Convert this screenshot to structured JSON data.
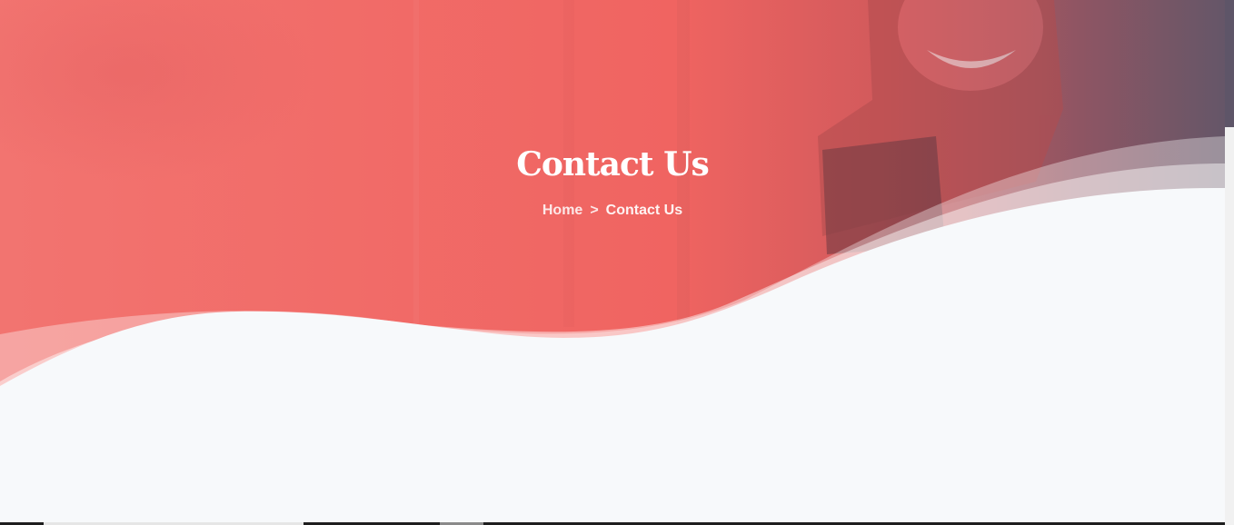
{
  "hero": {
    "title": "Contact Us",
    "breadcrumb": {
      "home_label": "Home",
      "separator": ">",
      "current_label": "Contact Us"
    }
  },
  "colors": {
    "hero_coral": "#f06864",
    "hero_dark": "#5e5568",
    "page_background": "#f7f9fb",
    "text_light": "#ffffff"
  }
}
